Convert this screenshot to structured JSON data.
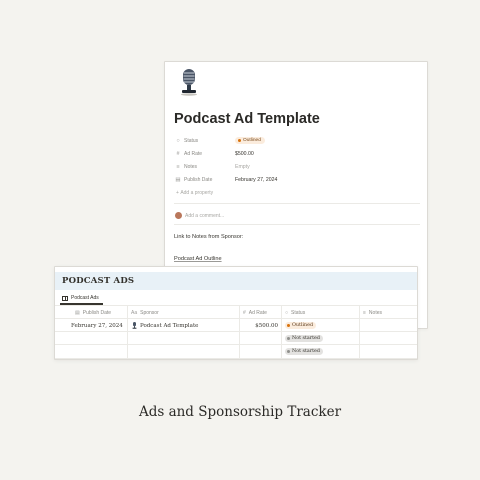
{
  "page": {
    "title": "Podcast Ad Template",
    "icon": "microphone-icon",
    "properties": [
      {
        "icon": "status-icon",
        "label": "Status",
        "value": "Outlined",
        "type": "status"
      },
      {
        "icon": "number-icon",
        "label": "Ad Rate",
        "value": "$500.00",
        "type": "text"
      },
      {
        "icon": "text-lines-icon",
        "label": "Notes",
        "value": "Empty",
        "type": "empty"
      },
      {
        "icon": "calendar-icon",
        "label": "Publish Date",
        "value": "February 27, 2024",
        "type": "text"
      }
    ],
    "add_property": "Add a property",
    "comment_placeholder": "Add a comment...",
    "body": {
      "link_label": "Link to Notes from Sponsor:",
      "outline_link": "Podcast Ad Outline"
    }
  },
  "database": {
    "title": "PODCAST ADS",
    "view_tab": "Podcast Ads",
    "columns": [
      {
        "icon": "calendar-icon",
        "label": "Publish Date"
      },
      {
        "icon": "text-icon",
        "label": "Sponsor"
      },
      {
        "icon": "number-icon",
        "label": "Ad Rate"
      },
      {
        "icon": "status-icon",
        "label": "Status"
      },
      {
        "icon": "text-lines-icon",
        "label": "Notes"
      }
    ],
    "rows": [
      {
        "publish_date": "February 27, 2024",
        "sponsor": "Podcast Ad Template",
        "ad_rate": "$500.00",
        "status": "Outlined",
        "notes": ""
      },
      {
        "publish_date": "",
        "sponsor": "",
        "ad_rate": "",
        "status": "Not started",
        "notes": ""
      },
      {
        "publish_date": "",
        "sponsor": "",
        "ad_rate": "",
        "status": "Not started",
        "notes": ""
      }
    ]
  },
  "caption": "Ads and Sponsorship Tracker",
  "colors": {
    "background": "#f4f3ef",
    "db_header": "#e8f1f7",
    "outlined_pill": "#fbecdd",
    "not_started_pill": "#e3e2e0"
  }
}
